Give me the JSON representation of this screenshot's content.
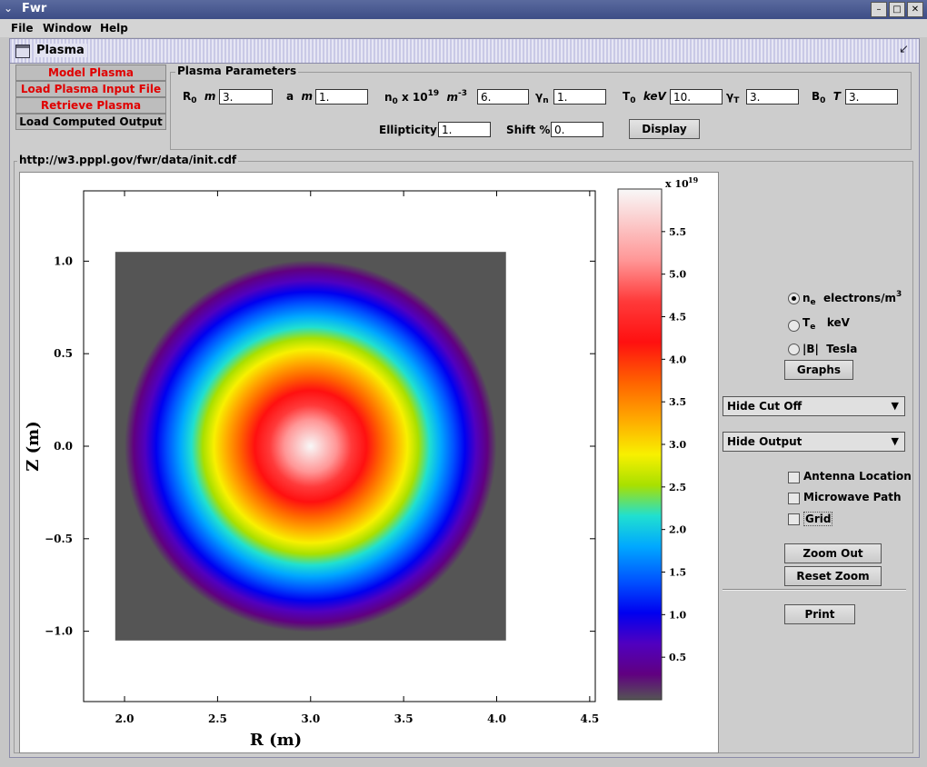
{
  "window": {
    "title": "Fwr"
  },
  "menu": [
    "File",
    "Window",
    "Help"
  ],
  "internal_frame": {
    "title": "Plasma"
  },
  "tabs": [
    "Model Plasma",
    "Load Plasma Input File",
    "Retrieve Plasma",
    "Load Computed Output"
  ],
  "params": {
    "group_title": "Plasma Parameters",
    "R0": {
      "value": "3.",
      "unit": "m"
    },
    "a": {
      "value": "1.",
      "unit": "m"
    },
    "n0": {
      "value": "6.",
      "unit": "m",
      "exponent": "19"
    },
    "gamma_n": {
      "value": "1."
    },
    "T0": {
      "value": "10.",
      "unit": "keV"
    },
    "gamma_T": {
      "value": "3."
    },
    "B0": {
      "value": "3.",
      "unit": "T"
    },
    "ellipticity": {
      "label": "Ellipticity",
      "value": "1."
    },
    "shift": {
      "label": "Shift %",
      "value": "0."
    },
    "display_button": "Display"
  },
  "plot_group_title": "http://w3.pppl.gov/fwr/data/init.cdf",
  "plot": {
    "xlabel": "R (m)",
    "ylabel": "Z (m)",
    "x_ticks": [
      "2.0",
      "2.5",
      "3.0",
      "3.5",
      "4.0",
      "4.5"
    ],
    "y_ticks": [
      "1.0",
      "0.5",
      "0.0",
      "−0.5",
      "−1.0"
    ],
    "colorbar_ticks": [
      "5.5",
      "5.0",
      "4.5",
      "4.0",
      "3.5",
      "3.0",
      "2.5",
      "2.0",
      "1.5",
      "1.0",
      "0.5"
    ],
    "colorbar_exponent": "19"
  },
  "chart_data": {
    "type": "heatmap",
    "title": "",
    "xlabel": "R (m)",
    "ylabel": "Z (m)",
    "xlim": [
      1.78,
      4.53
    ],
    "ylim": [
      -1.38,
      1.38
    ],
    "data_extent": {
      "r": [
        1.95,
        4.05
      ],
      "z": [
        -1.05,
        1.05
      ]
    },
    "center": {
      "R": 3.0,
      "Z": 0.0
    },
    "minor_radius": 1.0,
    "peak_value": 6.0,
    "colorbar": {
      "range": [
        0,
        6
      ],
      "ticks": [
        0.5,
        1.0,
        1.5,
        2.0,
        2.5,
        3.0,
        3.5,
        4.0,
        4.5,
        5.0,
        5.5
      ],
      "scale_label": "x 10^19"
    },
    "background_color": "#555555"
  },
  "quantity_options": [
    {
      "main": "n",
      "sub": "e",
      "unit": "electrons/m",
      "sup": "3",
      "selected": true
    },
    {
      "main": "T",
      "sub": "e",
      "unit": "keV",
      "sup": "",
      "selected": false
    },
    {
      "main": "|B|",
      "sub": "",
      "unit": "Tesla",
      "sup": "",
      "selected": false
    }
  ],
  "graphs_button": "Graphs",
  "cutoff_select": "Hide Cut Off",
  "output_select": "Hide Output",
  "overlays": [
    {
      "label": "Antenna Location",
      "checked": false
    },
    {
      "label": "Microwave Path",
      "checked": false
    },
    {
      "label": "Grid",
      "checked": false
    }
  ],
  "zoom_out_button": "Zoom Out",
  "reset_zoom_button": "Reset Zoom",
  "print_button": "Print"
}
